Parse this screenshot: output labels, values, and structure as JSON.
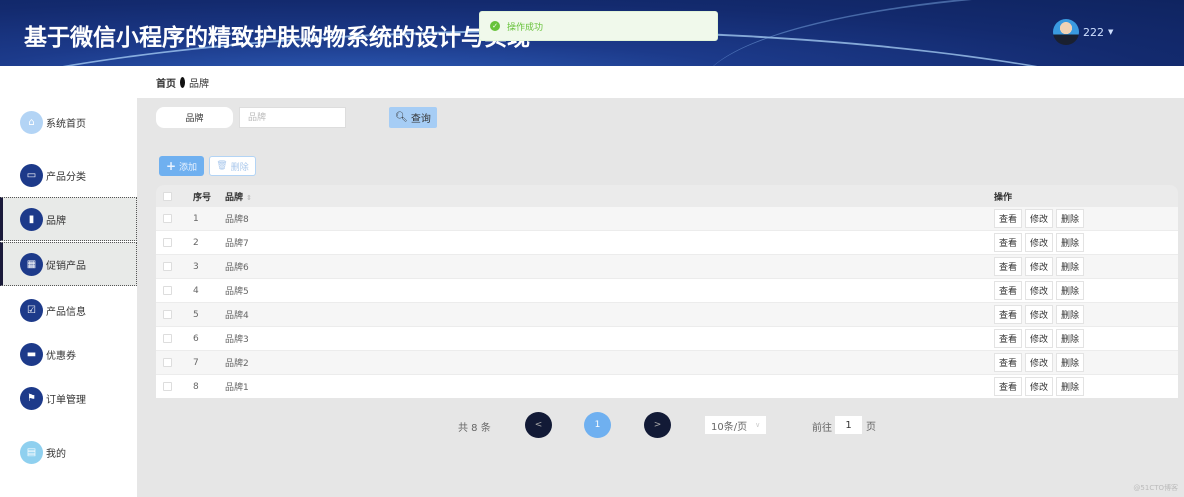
{
  "header": {
    "title": "基于微信小程序的精致护肤购物系统的设计与实现",
    "username": "222"
  },
  "toast": {
    "message": "操作成功"
  },
  "sidebar": {
    "items": [
      {
        "label": "系统首页",
        "icon": "home-icon"
      },
      {
        "label": "产品分类",
        "icon": "monitor-icon"
      },
      {
        "label": "品牌",
        "icon": "book-icon"
      },
      {
        "label": "促销产品",
        "icon": "grid-icon"
      },
      {
        "label": "产品信息",
        "icon": "clipboard-icon"
      },
      {
        "label": "优惠券",
        "icon": "ticket-icon"
      },
      {
        "label": "订单管理",
        "icon": "flag-icon"
      },
      {
        "label": "我的",
        "icon": "card-icon"
      }
    ]
  },
  "breadcrumb": {
    "home": "首页",
    "current": "品牌"
  },
  "search": {
    "label": "品牌",
    "placeholder": "品牌",
    "button": "查询"
  },
  "actions": {
    "add": "添加",
    "delete": "删除"
  },
  "table": {
    "headers": {
      "index": "序号",
      "name": "品牌",
      "ops": "操作"
    },
    "op_labels": {
      "view": "查看",
      "edit": "修改",
      "delete": "删除"
    },
    "rows": [
      {
        "index": "1",
        "name": "品牌8"
      },
      {
        "index": "2",
        "name": "品牌7"
      },
      {
        "index": "3",
        "name": "品牌6"
      },
      {
        "index": "4",
        "name": "品牌5"
      },
      {
        "index": "5",
        "name": "品牌4"
      },
      {
        "index": "6",
        "name": "品牌3"
      },
      {
        "index": "7",
        "name": "品牌2"
      },
      {
        "index": "8",
        "name": "品牌1"
      }
    ]
  },
  "pagination": {
    "total": "共 8 条",
    "prev": "<",
    "current": "1",
    "next": ">",
    "page_size": "10条/页",
    "goto_label": "前往",
    "goto_value": "1",
    "goto_suffix": "页"
  },
  "watermark": "@51CTO博客"
}
